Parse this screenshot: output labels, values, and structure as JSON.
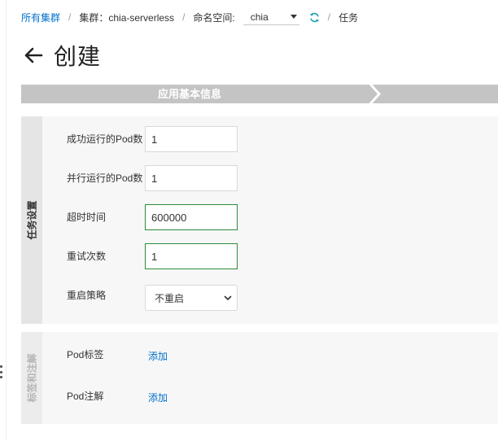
{
  "breadcrumb": {
    "all_clusters": "所有集群",
    "cluster_label": "集群：chia-serverless",
    "namespace_label": "命名空间:",
    "namespace_value": "chia",
    "current": "任务",
    "separator": "/"
  },
  "page": {
    "title": "创建"
  },
  "steps": {
    "current": "应用基本信息"
  },
  "task_settings": {
    "section_title": "任务设置",
    "fields": [
      {
        "label": "成功运行的Pod数",
        "value": "1"
      },
      {
        "label": "并行运行的Pod数",
        "value": "1"
      },
      {
        "label": "超时时间",
        "value": "600000"
      },
      {
        "label": "重试次数",
        "value": "1"
      }
    ],
    "restart_policy": {
      "label": "重启策略",
      "value": "不重启"
    }
  },
  "labels_annotations": {
    "section_title": "标签和注解",
    "pod_labels": {
      "label": "Pod标签",
      "action": "添加"
    },
    "pod_annotations": {
      "label": "Pod注解",
      "action": "添加"
    }
  },
  "colors": {
    "link": "#0070cc",
    "valid_border": "#2e8b3a",
    "step_bar": "#c4c4c4",
    "section_bg": "#f7f7f7"
  },
  "icons": {
    "back": "arrow-left-icon",
    "refresh": "refresh-icon",
    "dropdown": "caret-down-icon",
    "select": "chevron-down-icon"
  }
}
